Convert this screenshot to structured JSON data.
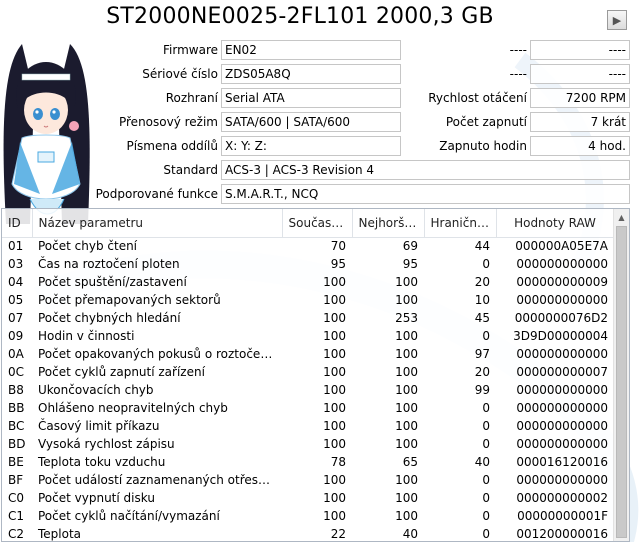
{
  "header": {
    "title": "ST2000NE0025-2FL101 2000,3 GB",
    "next_icon": "play-triangle-icon"
  },
  "info": {
    "firmware": {
      "label": "Firmware",
      "value": "EN02"
    },
    "serial": {
      "label": "Sériové číslo",
      "value": "ZDS05A8Q"
    },
    "interface": {
      "label": "Rozhraní",
      "value": "Serial ATA"
    },
    "transfer": {
      "label": "Přenosový režim",
      "value": "SATA/600 | SATA/600"
    },
    "letters": {
      "label": "Písmena oddílů",
      "value": "X: Y: Z:"
    },
    "standard": {
      "label": "Standard",
      "value": "ACS-3 | ACS-3 Revision 4"
    },
    "features": {
      "label": "Podporované funkce",
      "value": "S.M.A.R.T., NCQ"
    },
    "right_top_1": {
      "label": "----",
      "value": "----"
    },
    "right_top_2": {
      "label": "----",
      "value": "----"
    },
    "rpm": {
      "label": "Rychlost otáčení",
      "value": "7200 RPM"
    },
    "power_count": {
      "label": "Počet zapnutí",
      "value": "7 krát"
    },
    "power_hours": {
      "label": "Zapnuto hodin",
      "value": "4 hod."
    }
  },
  "table": {
    "columns": {
      "id": "ID",
      "name": "Název parametru",
      "current": "Současn...",
      "worst": "Nejhorší...",
      "threshold": "Hraniční...",
      "raw": "Hodnoty RAW"
    },
    "rows": [
      {
        "id": "01",
        "name": "Počet chyb čtení",
        "current": "70",
        "worst": "69",
        "threshold": "44",
        "raw": "000000A05E7A"
      },
      {
        "id": "03",
        "name": "Čas na roztočení ploten",
        "current": "95",
        "worst": "95",
        "threshold": "0",
        "raw": "000000000000"
      },
      {
        "id": "04",
        "name": "Počet spuštění/zastavení",
        "current": "100",
        "worst": "100",
        "threshold": "20",
        "raw": "000000000009"
      },
      {
        "id": "05",
        "name": "Počet přemapovaných sektorů",
        "current": "100",
        "worst": "100",
        "threshold": "10",
        "raw": "000000000000"
      },
      {
        "id": "07",
        "name": "Počet chybných hledání",
        "current": "100",
        "worst": "253",
        "threshold": "45",
        "raw": "0000000076D2"
      },
      {
        "id": "09",
        "name": "Hodin v činnosti",
        "current": "100",
        "worst": "100",
        "threshold": "0",
        "raw": "3D9D00000004"
      },
      {
        "id": "0A",
        "name": "Počet opakovaných pokusů o roztočení p...",
        "current": "100",
        "worst": "100",
        "threshold": "97",
        "raw": "000000000000"
      },
      {
        "id": "0C",
        "name": "Počet cyklů zapnutí zařízení",
        "current": "100",
        "worst": "100",
        "threshold": "20",
        "raw": "000000000007"
      },
      {
        "id": "B8",
        "name": "Ukončovacích chyb",
        "current": "100",
        "worst": "100",
        "threshold": "99",
        "raw": "000000000000"
      },
      {
        "id": "BB",
        "name": "Ohlášeno neopravitelných chyb",
        "current": "100",
        "worst": "100",
        "threshold": "0",
        "raw": "000000000000"
      },
      {
        "id": "BC",
        "name": "Časový limit příkazu",
        "current": "100",
        "worst": "100",
        "threshold": "0",
        "raw": "000000000000"
      },
      {
        "id": "BD",
        "name": "Vysoká rychlost zápisu",
        "current": "100",
        "worst": "100",
        "threshold": "0",
        "raw": "000000000000"
      },
      {
        "id": "BE",
        "name": "Teplota toku vzduchu",
        "current": "78",
        "worst": "65",
        "threshold": "40",
        "raw": "000016120016"
      },
      {
        "id": "BF",
        "name": "Počet událostí zaznamenaných otřesový...",
        "current": "100",
        "worst": "100",
        "threshold": "0",
        "raw": "000000000000"
      },
      {
        "id": "C0",
        "name": "Počet vypnutí disku",
        "current": "100",
        "worst": "100",
        "threshold": "0",
        "raw": "000000000002"
      },
      {
        "id": "C1",
        "name": "Počet cyklů načítání/vymazání",
        "current": "100",
        "worst": "100",
        "threshold": "0",
        "raw": "00000000001F"
      },
      {
        "id": "C2",
        "name": "Teplota",
        "current": "22",
        "worst": "40",
        "threshold": "0",
        "raw": "001200000016"
      }
    ]
  },
  "colors": {
    "accent": "#3a7bd5",
    "border": "#c6c6c6",
    "mascot_hair": "#1b1b2e",
    "mascot_outfit": "#4aa8e0"
  }
}
